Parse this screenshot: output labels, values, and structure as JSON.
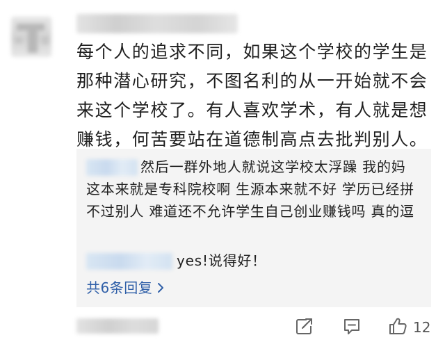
{
  "comment": {
    "text": "每个人的追求不同，如果这个学校的学生是\n那种潜心研究，不图名利的从一开始就不会\n来这个学校了。有人喜欢学术，有人就是想\n赚钱，何苦要站在道德制高点去批判别人。"
  },
  "replies": [
    {
      "text": "然后一群外地人就说这学校太浮躁 我的妈 这本来就是专科院校啊 生源本来就不好 学历已经拼不过别人 难道还不允许学生自己创业赚钱吗 真的逗"
    },
    {
      "text": "yes!说得好！"
    }
  ],
  "more_replies": {
    "label": "共6条回复",
    "icon": "chevron-right-icon"
  },
  "actions": {
    "share_icon": "share-icon",
    "comment_icon": "comment-icon",
    "like_icon": "thumbs-up-icon",
    "like_count": "12"
  },
  "colors": {
    "link": "#2f5fa8",
    "text": "#1f1f1f",
    "reply_bg": "#f4f4f4"
  }
}
